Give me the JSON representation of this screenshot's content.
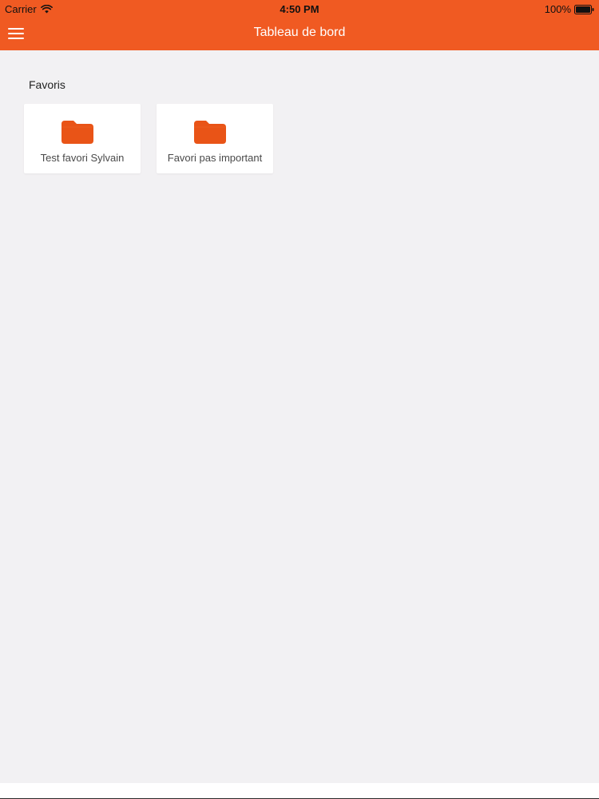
{
  "colors": {
    "accent": "#f05a22",
    "folder": "#e95417",
    "background": "#f2f1f3",
    "card": "#ffffff"
  },
  "status_bar": {
    "carrier": "Carrier",
    "time": "4:50 PM",
    "battery": "100%"
  },
  "header": {
    "menu_icon": "hamburger-menu-icon",
    "title": "Tableau de bord"
  },
  "favorites": {
    "title": "Favoris",
    "items": [
      {
        "label": "Test favori Sylvain",
        "icon": "folder-icon"
      },
      {
        "label": "Favori pas important",
        "icon": "folder-icon"
      }
    ]
  }
}
